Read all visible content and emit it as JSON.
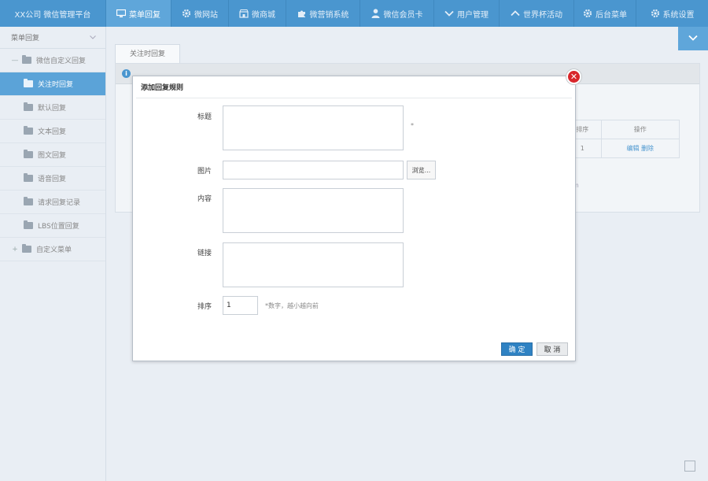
{
  "app": {
    "title": "XX公司 微信管理平台"
  },
  "nav": [
    {
      "label": "菜单回复",
      "icon": "monitor-icon",
      "active": true
    },
    {
      "label": "微网站",
      "icon": "gear-icon"
    },
    {
      "label": "微商城",
      "icon": "shop-icon"
    },
    {
      "label": "微营销系统",
      "icon": "puzzle-icon"
    },
    {
      "label": "微信会员卡",
      "icon": "user-icon"
    },
    {
      "label": "用户管理",
      "icon": "chevron-down-icon"
    },
    {
      "label": "世界杯活动",
      "icon": "chevron-up-icon"
    },
    {
      "label": "后台菜单",
      "icon": "gear-icon"
    },
    {
      "label": "系统设置",
      "icon": "gear-icon"
    }
  ],
  "sidebar": {
    "header": "菜单回复",
    "items": [
      {
        "label": "微信自定义回复",
        "toggle": "—",
        "level": "top"
      },
      {
        "label": "关注时回复",
        "level": "sub",
        "active": true
      },
      {
        "label": "默认回复",
        "level": "sub"
      },
      {
        "label": "文本回复",
        "level": "sub"
      },
      {
        "label": "图文回复",
        "level": "sub"
      },
      {
        "label": "语音回复",
        "level": "sub"
      },
      {
        "label": "请求回复记录",
        "level": "sub"
      },
      {
        "label": "LBS位置回复",
        "level": "sub"
      },
      {
        "label": "自定义菜单",
        "toggle": "+",
        "level": "top"
      }
    ]
  },
  "main": {
    "tab": "关注时回复",
    "table": {
      "headers": [
        "排序",
        "操作"
      ],
      "row": {
        "sort": "1",
        "edit": "编辑",
        "delete": "删除",
        "partial": "m"
      }
    }
  },
  "dialog": {
    "title": "添加回复规则",
    "fields": {
      "title_label": "标题",
      "required_mark": "*",
      "image_label": "图片",
      "browse_label": "浏览...",
      "content_label": "内容",
      "link_label": "链接",
      "sort_label": "排序",
      "sort_value": "1",
      "sort_hint": "*数字，越小越向前"
    },
    "ok_label": "确 定",
    "cancel_label": "取 消"
  },
  "colors": {
    "accent": "#4a96cf",
    "close": "#d8262b",
    "primary_button": "#2f82c3"
  }
}
